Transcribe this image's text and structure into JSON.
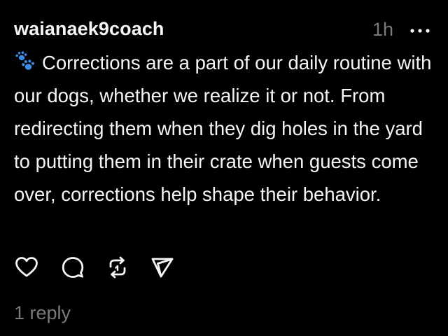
{
  "post": {
    "username": "waianaek9coach",
    "timestamp": "1h",
    "emoji_icon": "paw-prints-icon",
    "text": "Corrections are a part of our daily routine with our dogs, whether we realize it or not. From redirecting them when they dig holes in the yard to putting them in their crate when guests come over, corrections help shape their behavior.",
    "reply_count_label": "1 reply"
  },
  "actions": {
    "like_icon": "heart-icon",
    "comment_icon": "comment-icon",
    "repost_icon": "repost-icon",
    "share_icon": "send-icon",
    "more_icon": "more-icon"
  },
  "colors": {
    "background": "#000000",
    "text_primary": "#f3f5f7",
    "text_secondary": "#7a7a7a",
    "emoji_blue": "#3a8ee6"
  }
}
